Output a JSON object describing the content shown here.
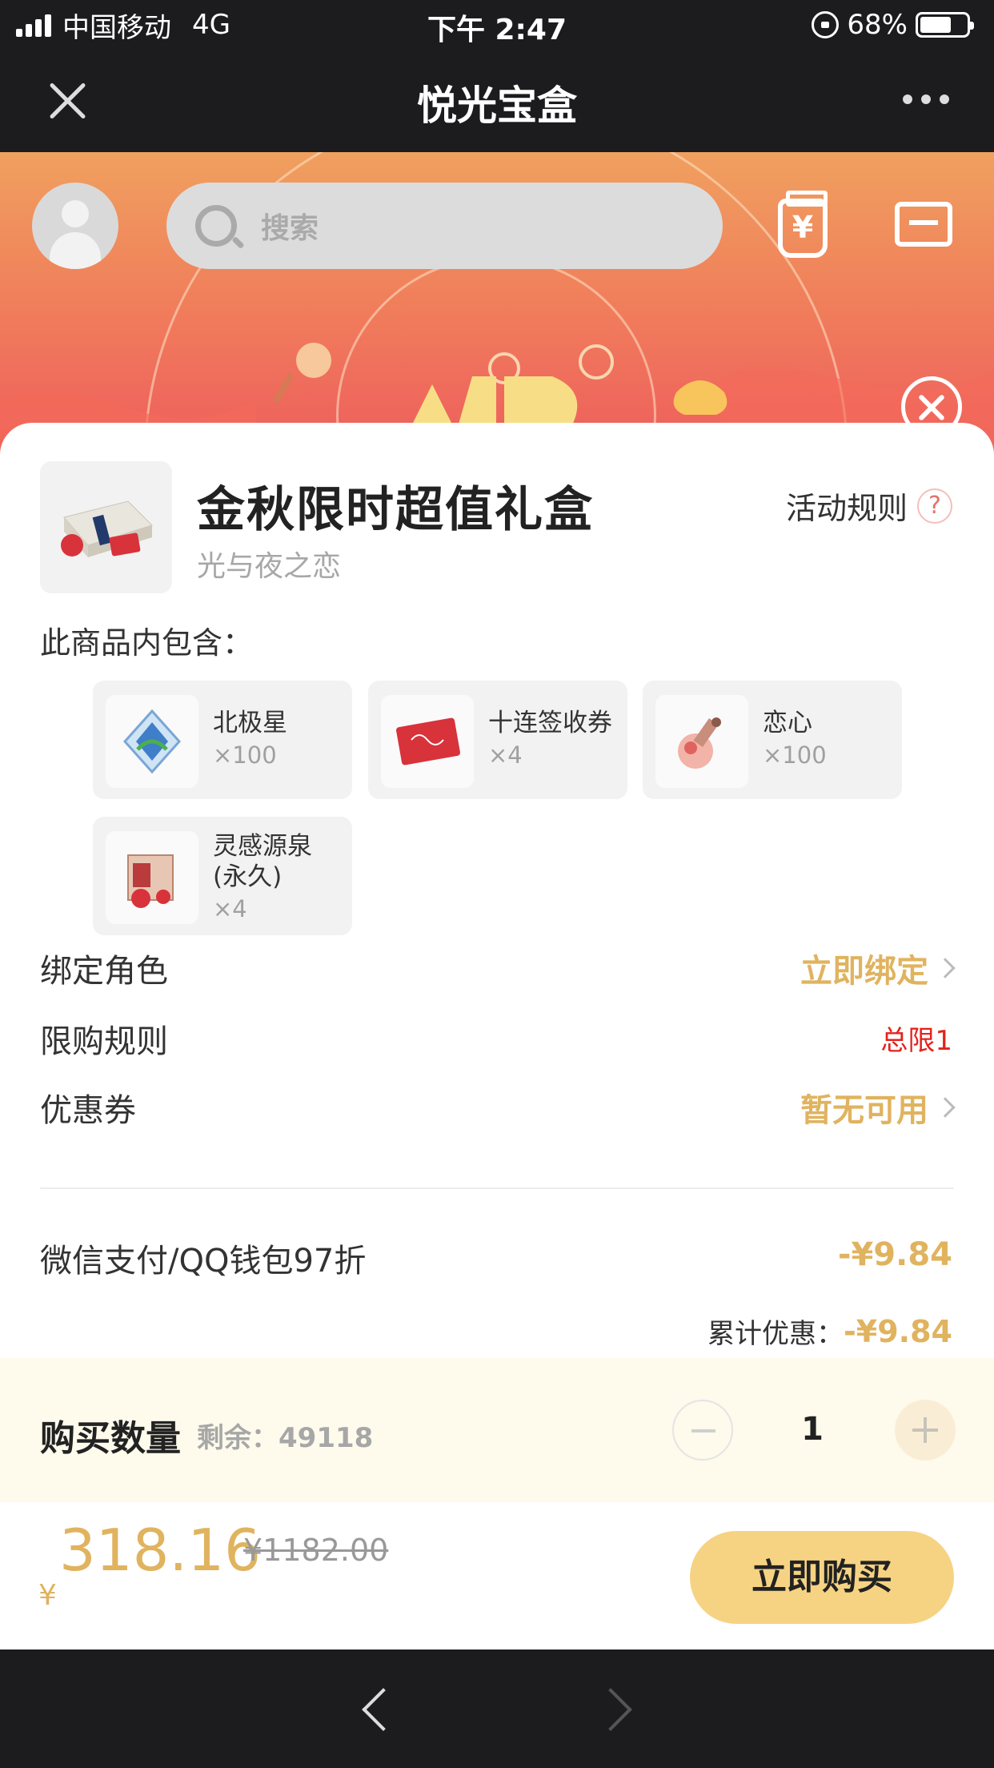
{
  "status_bar": {
    "carrier": "中国移动",
    "network": "4G",
    "time": "下午 2:47",
    "battery": "68%",
    "battery_level": 0.68
  },
  "nav": {
    "title": "悦光宝盒"
  },
  "search": {
    "placeholder": "搜索"
  },
  "coin_symbol": "¥",
  "product": {
    "title": "金秋限时超值礼盒",
    "game": "光与夜之恋",
    "rules_label": "活动规则",
    "help_symbol": "?"
  },
  "contents": {
    "label": "此商品内包含：",
    "items": [
      {
        "name": "北极星",
        "qty": "×100"
      },
      {
        "name": "十连签收券",
        "qty": "×4"
      },
      {
        "name": "恋心",
        "qty": "×100"
      },
      {
        "name": "灵感源泉(永久)",
        "qty": "×4"
      }
    ]
  },
  "rows": {
    "bind": {
      "label": "绑定角色",
      "value": "立即绑定"
    },
    "limit": {
      "label": "限购规则",
      "value": "总限1"
    },
    "coupon": {
      "label": "优惠券",
      "value": "暂无可用"
    }
  },
  "discount": {
    "label": "微信支付/QQ钱包97折",
    "value": "-¥9.84",
    "total_label": "累计优惠：",
    "total_value": "-¥9.84"
  },
  "quantity": {
    "label": "购买数量",
    "remaining": "剩余：49118",
    "value": "1"
  },
  "footer": {
    "currency": "¥",
    "price": "318.16",
    "original_price": "¥1182.00",
    "buy_label": "立即购买"
  },
  "colors": {
    "accent_gold": "#e0b35f",
    "buy_button": "#f6d383",
    "limit_red": "#e5211c",
    "banner_top": "#f0a05f",
    "banner_bottom": "#ee5d5d"
  }
}
